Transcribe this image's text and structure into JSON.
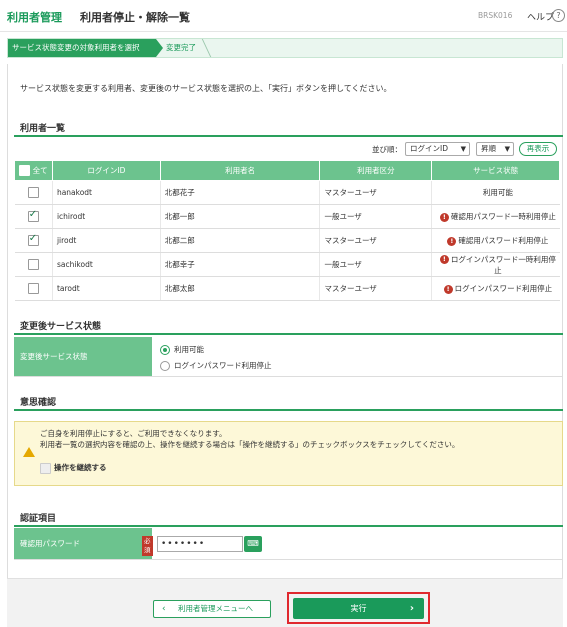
{
  "header": {
    "app_title": "利用者管理",
    "page_title": "利用者停止・解除一覧",
    "screen_id": "BRSK016",
    "help_label": "ヘルプ",
    "help_icon": "?"
  },
  "steps": {
    "step1": "サービス状態変更の対象利用者を選択",
    "step2": "変更完了"
  },
  "intro": "サービス状態を変更する利用者、変更後のサービス状態を選択の上、「実行」ボタンを押してください。",
  "user_list": {
    "title": "利用者一覧",
    "sort_label": "並び順：",
    "sort_field": "ログインID",
    "sort_order": "昇順",
    "refresh_label": "再表示",
    "columns": {
      "all": "全て",
      "login_id": "ログインID",
      "name": "利用者名",
      "category": "利用者区分",
      "status": "サービス状態"
    },
    "rows": [
      {
        "checked": false,
        "login_id": "hanakodt",
        "name": "北都花子",
        "category": "マスターユーザ",
        "status": "利用可能",
        "warning": false
      },
      {
        "checked": true,
        "login_id": "ichirodt",
        "name": "北都一郎",
        "category": "一般ユーザ",
        "status": "確認用パスワード一時利用停止",
        "warning": true
      },
      {
        "checked": true,
        "login_id": "jirodt",
        "name": "北都二郎",
        "category": "マスターユーザ",
        "status": "確認用パスワード利用停止",
        "warning": true
      },
      {
        "checked": false,
        "login_id": "sachikodt",
        "name": "北都幸子",
        "category": "一般ユーザ",
        "status": "ログインパスワード一時利用停止",
        "warning": true
      },
      {
        "checked": false,
        "login_id": "tarodt",
        "name": "北都太郎",
        "category": "マスターユーザ",
        "status": "ログインパスワード利用停止",
        "warning": true
      }
    ]
  },
  "new_status": {
    "title": "変更後サービス状態",
    "label": "変更後サービス状態",
    "options": [
      "利用可能",
      "ログインパスワード利用停止"
    ],
    "selected": 0
  },
  "confirm": {
    "title": "意思確認",
    "line1": "ご自身を利用停止にすると、ご利用できなくなります。",
    "line2": "利用者一覧の選択内容を確認の上、操作を継続する場合は「操作を継続する」のチェックボックスをチェックしてください。",
    "continue_label": "操作を継続する"
  },
  "auth": {
    "title": "認証項目",
    "label": "確認用パスワード",
    "required": "必須",
    "password_value": "•••••••",
    "keyboard_icon": "software-keyboard-icon"
  },
  "footer": {
    "back_label": "利用者管理メニューへ",
    "execute_label": "実行"
  },
  "colors": {
    "accent": "#2aa05d",
    "header_green": "#6cc38e",
    "warning_red": "#c0392b",
    "highlight_red": "#e0282e"
  }
}
